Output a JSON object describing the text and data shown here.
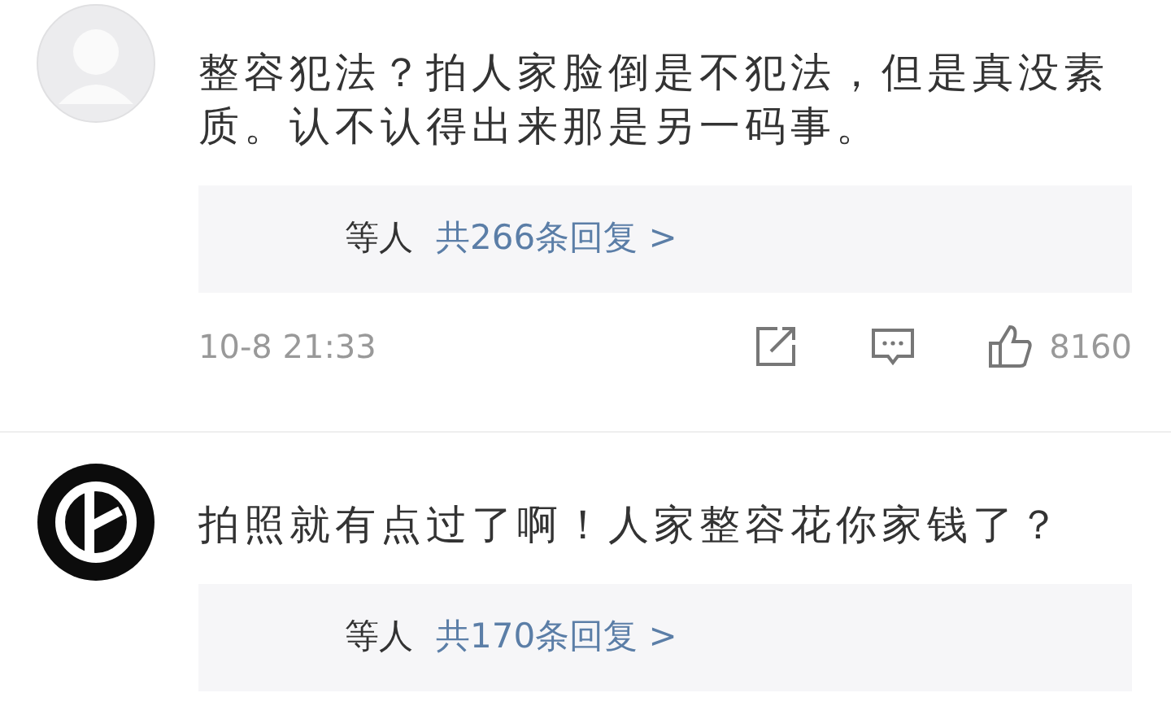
{
  "comments": [
    {
      "kind": "blank",
      "text": "整容犯法？拍人家脸倒是不犯法，但是真没素质。认不认得出来那是另一码事。",
      "replies": {
        "names": "等人",
        "link": "共266条回复 >"
      },
      "footer": {
        "time": "10-8 21:33",
        "likes": "8160"
      }
    },
    {
      "kind": "dark",
      "text": "拍照就有点过了啊！人家整容花你家钱了？",
      "replies": {
        "names": "等人",
        "link": "共170条回复 >"
      }
    }
  ]
}
